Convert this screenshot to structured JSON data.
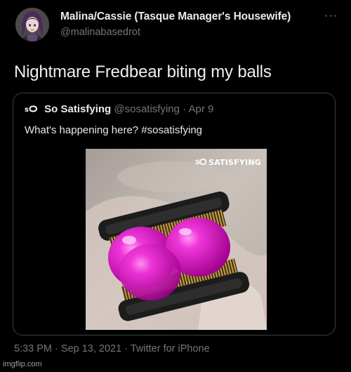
{
  "author": {
    "display_name": "Malina/Cassie (Tasque Manager's Housewife)",
    "handle": "@malinabasedrot",
    "more_label": "···"
  },
  "tweet": {
    "text": "Nightmare Fredbear biting my balls"
  },
  "quoted": {
    "name": "So Satisfying",
    "handle": "@sosatisfying",
    "separator": "·",
    "date": "Apr 9",
    "text": "What's happening here? #sosatisfying",
    "watermark": "SATISFYING"
  },
  "footer": {
    "time": "5:33 PM",
    "date": "Sep 13, 2021",
    "source": "Twitter for iPhone",
    "separator": "·"
  },
  "imgflip": "imgflip.com",
  "colors": {
    "background": "#000000",
    "secondary_text": "#71767b",
    "border": "#3b3f44",
    "ball": "#e01ec8"
  }
}
